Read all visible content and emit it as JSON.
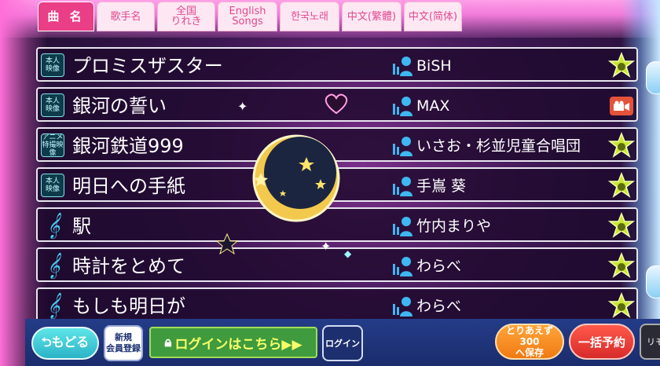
{
  "tabs": [
    {
      "label": "曲 名",
      "active": true
    },
    {
      "label": "歌手名",
      "active": false
    },
    {
      "label": "全国\nりれき",
      "active": false
    },
    {
      "label": "English\nSongs",
      "active": false
    },
    {
      "label": "한국노래",
      "active": false
    },
    {
      "label": "中文(繁體)",
      "active": false
    },
    {
      "label": "中文(简体)",
      "active": false
    }
  ],
  "songs": [
    {
      "badge": "本人\n映像",
      "title": "プロミスザスター",
      "artist": "BiSH",
      "action": "star"
    },
    {
      "badge": "本人\n映像",
      "title": "銀河の誓い",
      "artist": "MAX",
      "action": "movie"
    },
    {
      "badge": "アニメ\n特撮映像",
      "title": "銀河鉄道999",
      "artist": "いさお・杉並児童合唱団",
      "action": "star"
    },
    {
      "badge": "本人\n映像",
      "title": "明日への手紙",
      "artist": "手嶌 葵",
      "action": "star"
    },
    {
      "badge": "",
      "title": "駅",
      "artist": "竹内まりや",
      "action": "star"
    },
    {
      "badge": "",
      "title": "時計をとめて",
      "artist": "わらべ",
      "action": "star"
    },
    {
      "badge": "",
      "title": "もしも明日が",
      "artist": "わらべ",
      "action": "star"
    }
  ],
  "bottom": {
    "back_label": "⮌もどる",
    "new_member_label": "新規\n会員登録",
    "login_here_label": "ログインはこちら▶▶",
    "login_label": "ログイン",
    "save_label": "とりあえず300\nへ保存",
    "bulk_reserve_label": "一括予約",
    "remote_label": "リモ"
  },
  "colors": {
    "accent_pink": "#ea3e86",
    "badge_cyan": "#7fe3ee",
    "login_green": "#3f9b3d",
    "save_orange": "#f07a12",
    "bulk_red": "#d72a2a"
  },
  "icons": {
    "singer": "singer-icon",
    "star": "star-icon",
    "movie": "movie-camera-icon",
    "note": "music-note-icon"
  }
}
